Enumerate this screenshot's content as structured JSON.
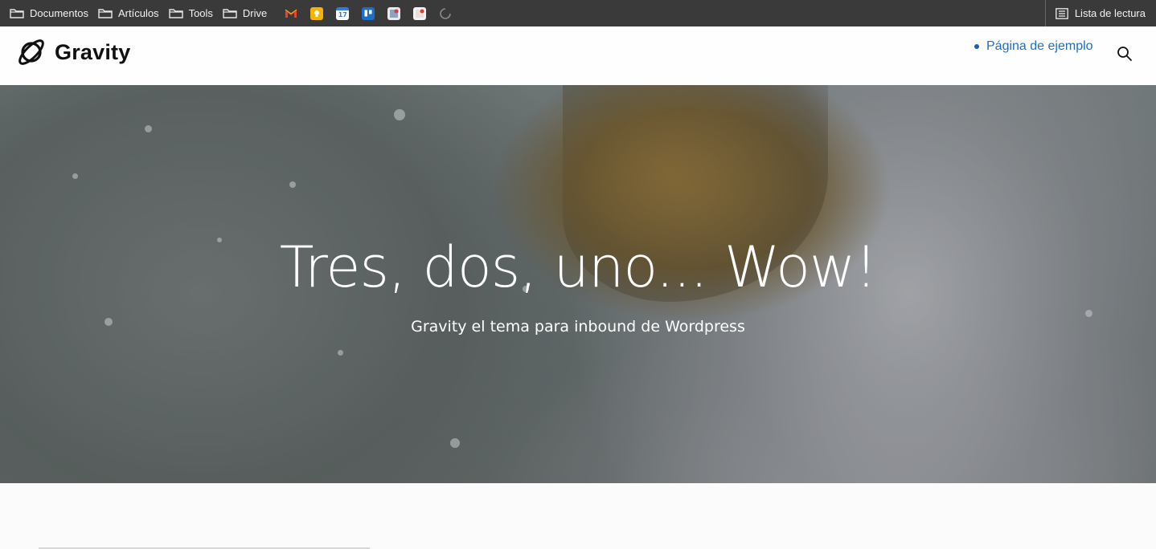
{
  "bookmarks": {
    "folders": [
      {
        "label": "Documentos",
        "icon": "folder-icon"
      },
      {
        "label": "Artículos",
        "icon": "folder-icon"
      },
      {
        "label": "Tools",
        "icon": "folder-icon"
      },
      {
        "label": "Drive",
        "icon": "folder-icon"
      }
    ],
    "apps": [
      {
        "name": "gmail-icon",
        "color": "#ffffff"
      },
      {
        "name": "keep-icon",
        "color": "#f6b400"
      },
      {
        "name": "calendar-icon",
        "color": "#2f7de1",
        "text": "17"
      },
      {
        "name": "trello-icon",
        "color": "#1b6fc9"
      },
      {
        "name": "app-icon-red",
        "color": "#e8e8e8"
      },
      {
        "name": "app-icon-notes",
        "color": "#f0f0f0"
      },
      {
        "name": "loading-icon",
        "color": "#888888"
      }
    ],
    "reading_list": "Lista de lectura"
  },
  "header": {
    "logo_text": "Gravity",
    "nav_items": [
      {
        "label": "Página de ejemplo"
      }
    ]
  },
  "hero": {
    "title": "Tres, dos, uno... Wow!",
    "subtitle": "Gravity el tema para inbound de Wordpress"
  },
  "colors": {
    "bookmarks_bg": "#3a3a3a",
    "link": "#1f6fc4"
  }
}
